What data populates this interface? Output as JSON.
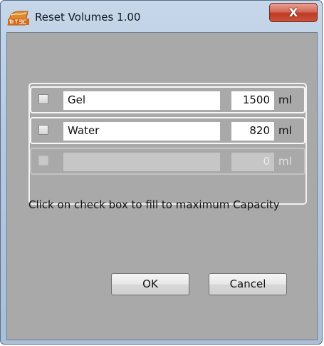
{
  "window": {
    "title": "Reset Volumes  1.00",
    "app_icon": "hitec-logo-icon",
    "close_label": "X"
  },
  "rows": [
    {
      "name": "Gel",
      "quantity": "1500",
      "unit": "ml",
      "enabled": true
    },
    {
      "name": "Water",
      "quantity": "820",
      "unit": "ml",
      "enabled": true
    },
    {
      "name": "",
      "quantity": "0",
      "unit": "ml",
      "enabled": false
    }
  ],
  "hint": "Click on check box to fill to maximum Capacity",
  "buttons": {
    "ok": "OK",
    "cancel": "Cancel"
  },
  "colors": {
    "client_bg": "#a9a9a9",
    "close_red": "#c8533c"
  }
}
